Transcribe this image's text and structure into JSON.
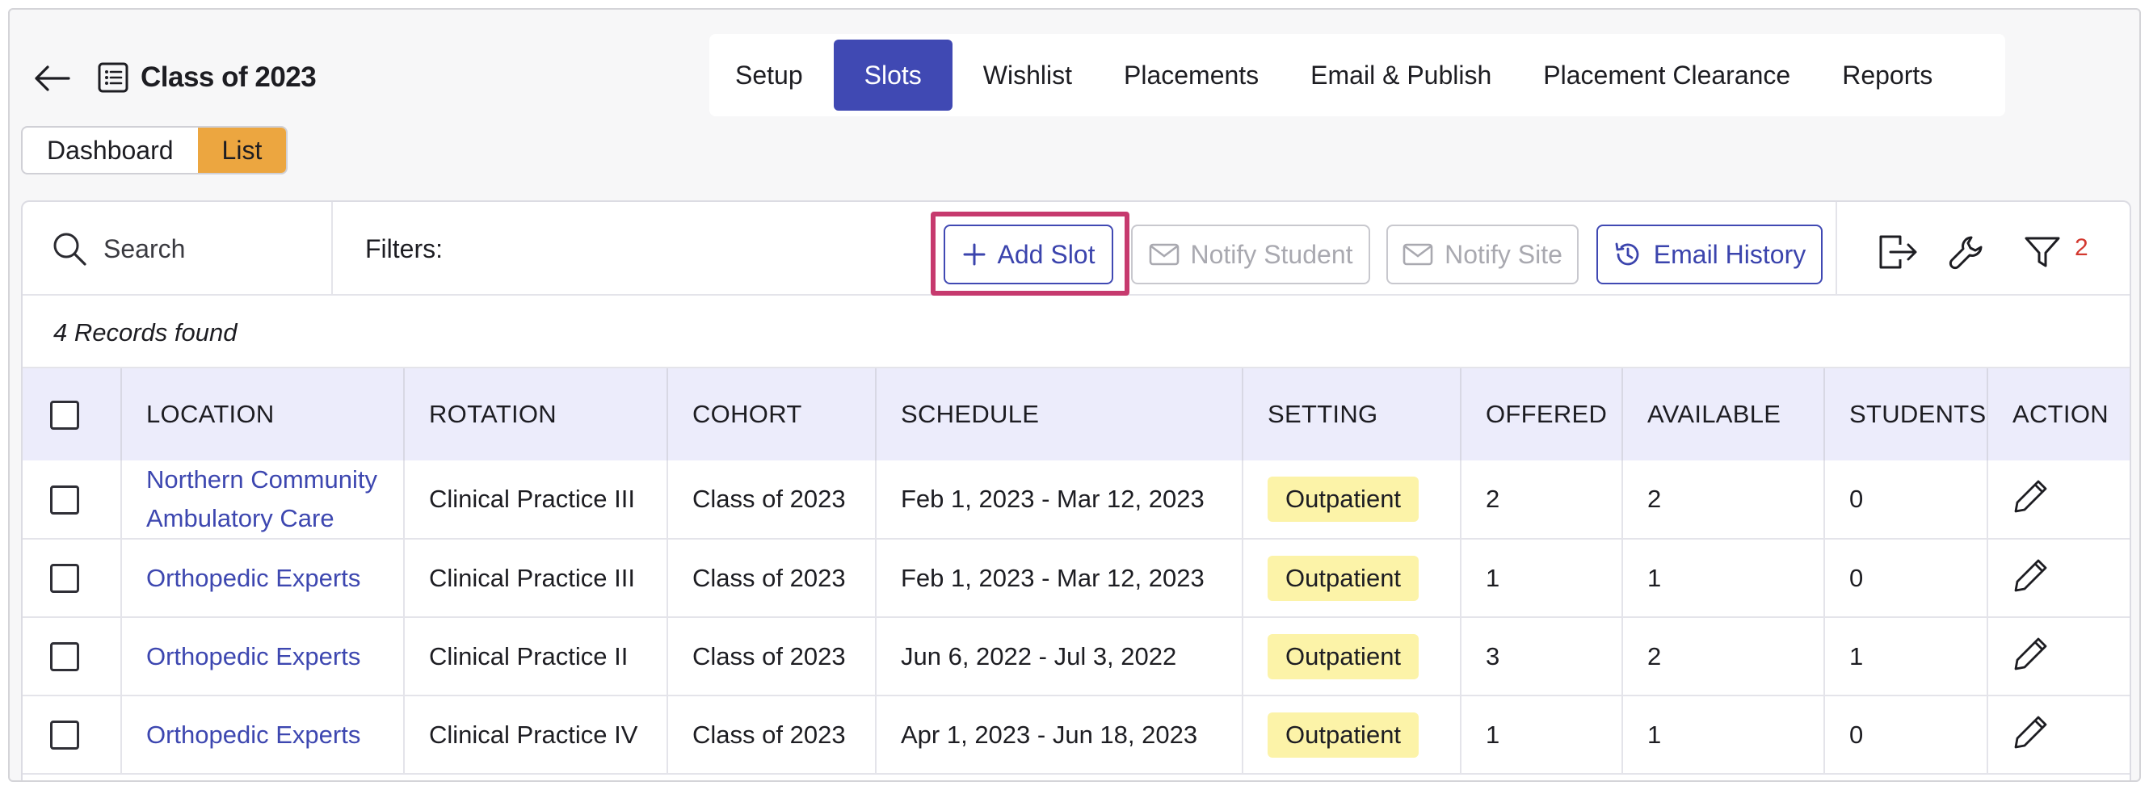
{
  "header": {
    "title": "Class of 2023",
    "tabs": [
      {
        "label": "Setup",
        "active": false
      },
      {
        "label": "Slots",
        "active": true
      },
      {
        "label": "Wishlist",
        "active": false
      },
      {
        "label": "Placements",
        "active": false
      },
      {
        "label": "Email & Publish",
        "active": false
      },
      {
        "label": "Placement Clearance",
        "active": false
      },
      {
        "label": "Reports",
        "active": false
      }
    ]
  },
  "view_toggle": {
    "dashboard_label": "Dashboard",
    "list_label": "List",
    "active": "List"
  },
  "toolbar": {
    "search_label": "Search",
    "filters_label": "Filters:",
    "add_slot_label": "Add Slot",
    "notify_student_label": "Notify Student",
    "notify_site_label": "Notify Site",
    "email_history_label": "Email History",
    "filter_count": "2"
  },
  "records_text": "4 Records found",
  "table": {
    "columns": [
      "LOCATION",
      "ROTATION",
      "COHORT",
      "SCHEDULE",
      "SETTING",
      "OFFERED",
      "AVAILABLE",
      "STUDENTS P",
      "ACTION"
    ],
    "rows": [
      {
        "location": "Northern Community Ambulatory Care",
        "rotation": "Clinical Practice III",
        "cohort": "Class of 2023",
        "schedule": "Feb 1, 2023 - Mar 12, 2023",
        "setting": "Outpatient",
        "offered": "2",
        "available": "2",
        "students": "0"
      },
      {
        "location": "Orthopedic Experts",
        "rotation": "Clinical Practice III",
        "cohort": "Class of 2023",
        "schedule": "Feb 1, 2023 - Mar 12, 2023",
        "setting": "Outpatient",
        "offered": "1",
        "available": "1",
        "students": "0"
      },
      {
        "location": "Orthopedic Experts",
        "rotation": "Clinical Practice II",
        "cohort": "Class of 2023",
        "schedule": "Jun 6, 2022 - Jul 3, 2022",
        "setting": "Outpatient",
        "offered": "3",
        "available": "2",
        "students": "1"
      },
      {
        "location": "Orthopedic Experts",
        "rotation": "Clinical Practice IV",
        "cohort": "Class of 2023",
        "schedule": "Apr 1, 2023 - Jun 18, 2023",
        "setting": "Outpatient",
        "offered": "1",
        "available": "1",
        "students": "0"
      }
    ]
  },
  "colors": {
    "accent": "#4049b3",
    "toggle_active": "#eca640",
    "highlight": "#c63a6e",
    "badge": "#fcf3a8",
    "filter_count": "#d3382f"
  }
}
